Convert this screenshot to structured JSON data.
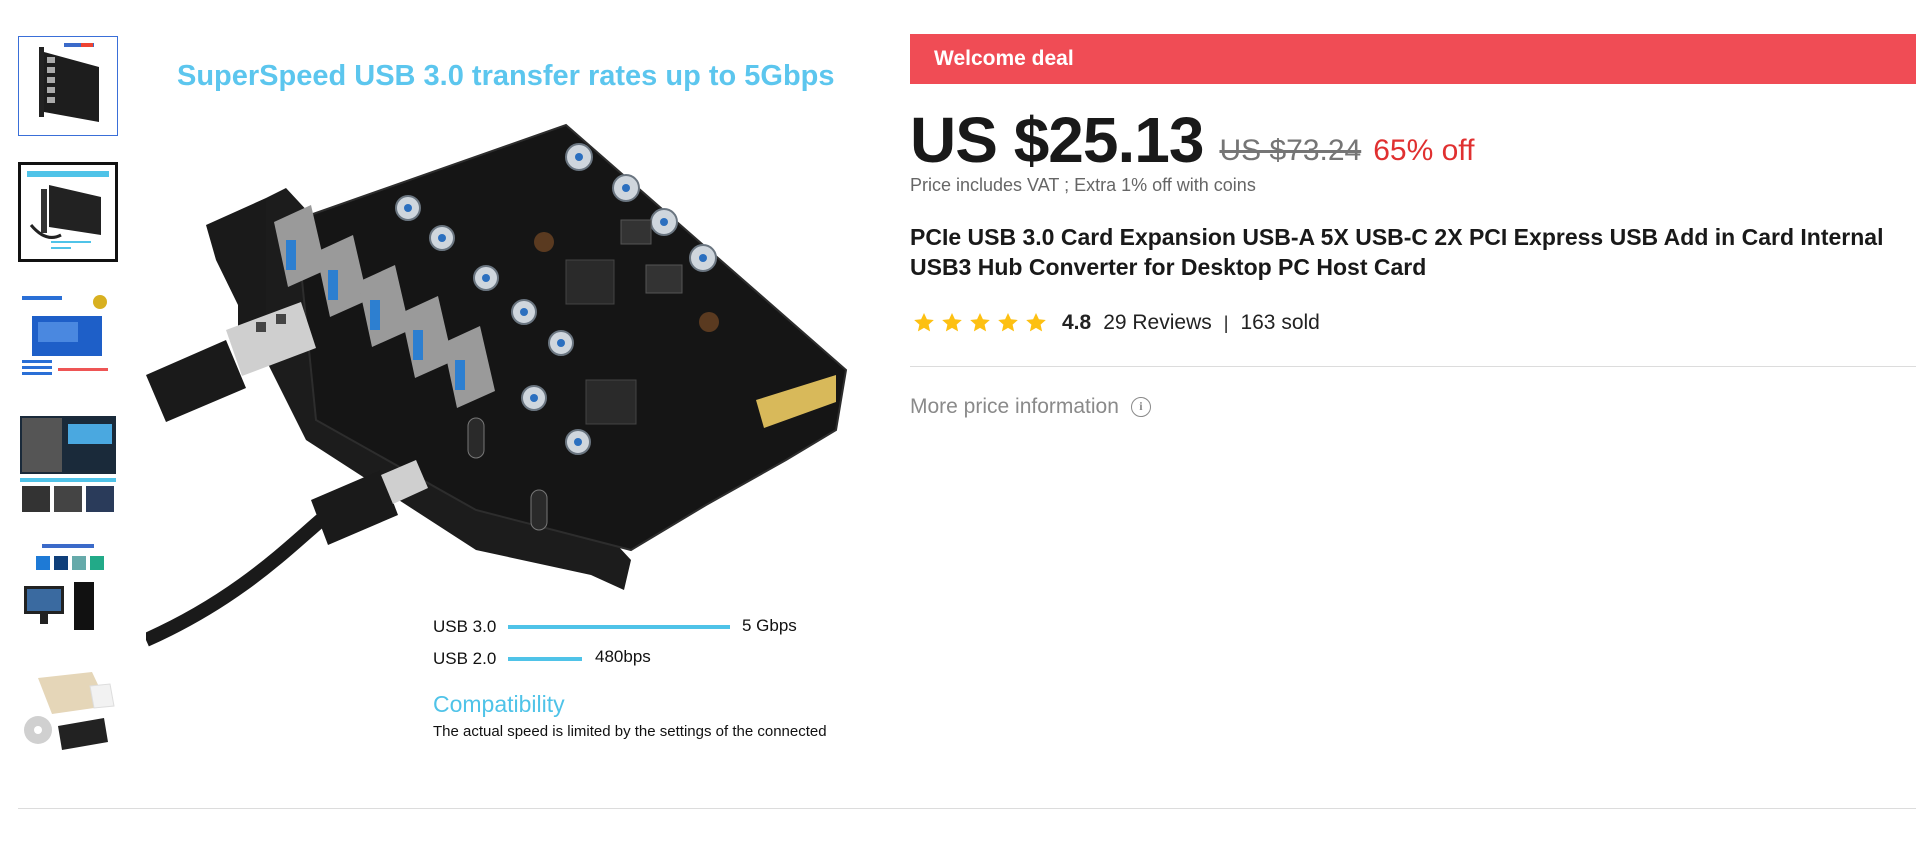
{
  "product": {
    "image_headline": "SuperSpeed USB 3.0 transfer rates up to 5Gbps",
    "image_labels": {
      "usb3_label": "USB 3.0",
      "usb3_speed": "5 Gbps",
      "usb2_label": "USB 2.0",
      "usb2_speed": "480bps",
      "compat_title": "Compatibility",
      "compat_text": "The actual speed is limited by the settings of the connected"
    },
    "thumbnails_count": 6
  },
  "deal": {
    "label": "Welcome deal",
    "bar_color": "#f04c55"
  },
  "price": {
    "current": "US $25.13",
    "original": "US $73.24",
    "discount": "65% off",
    "note": "Price includes VAT ; Extra 1% off with coins",
    "discount_color": "#e03030"
  },
  "title": "PCIe USB 3.0 Card Expansion USB-A 5X USB-C 2X PCI Express USB Add in Card Internal USB3 Hub Converter for Desktop PC Host Card",
  "rating": {
    "score": "4.8",
    "stars": 4.8,
    "reviews": "29 Reviews",
    "separator": "|",
    "sold": "163 sold",
    "star_color": "#fdc012"
  },
  "more_price_info": "More price information"
}
